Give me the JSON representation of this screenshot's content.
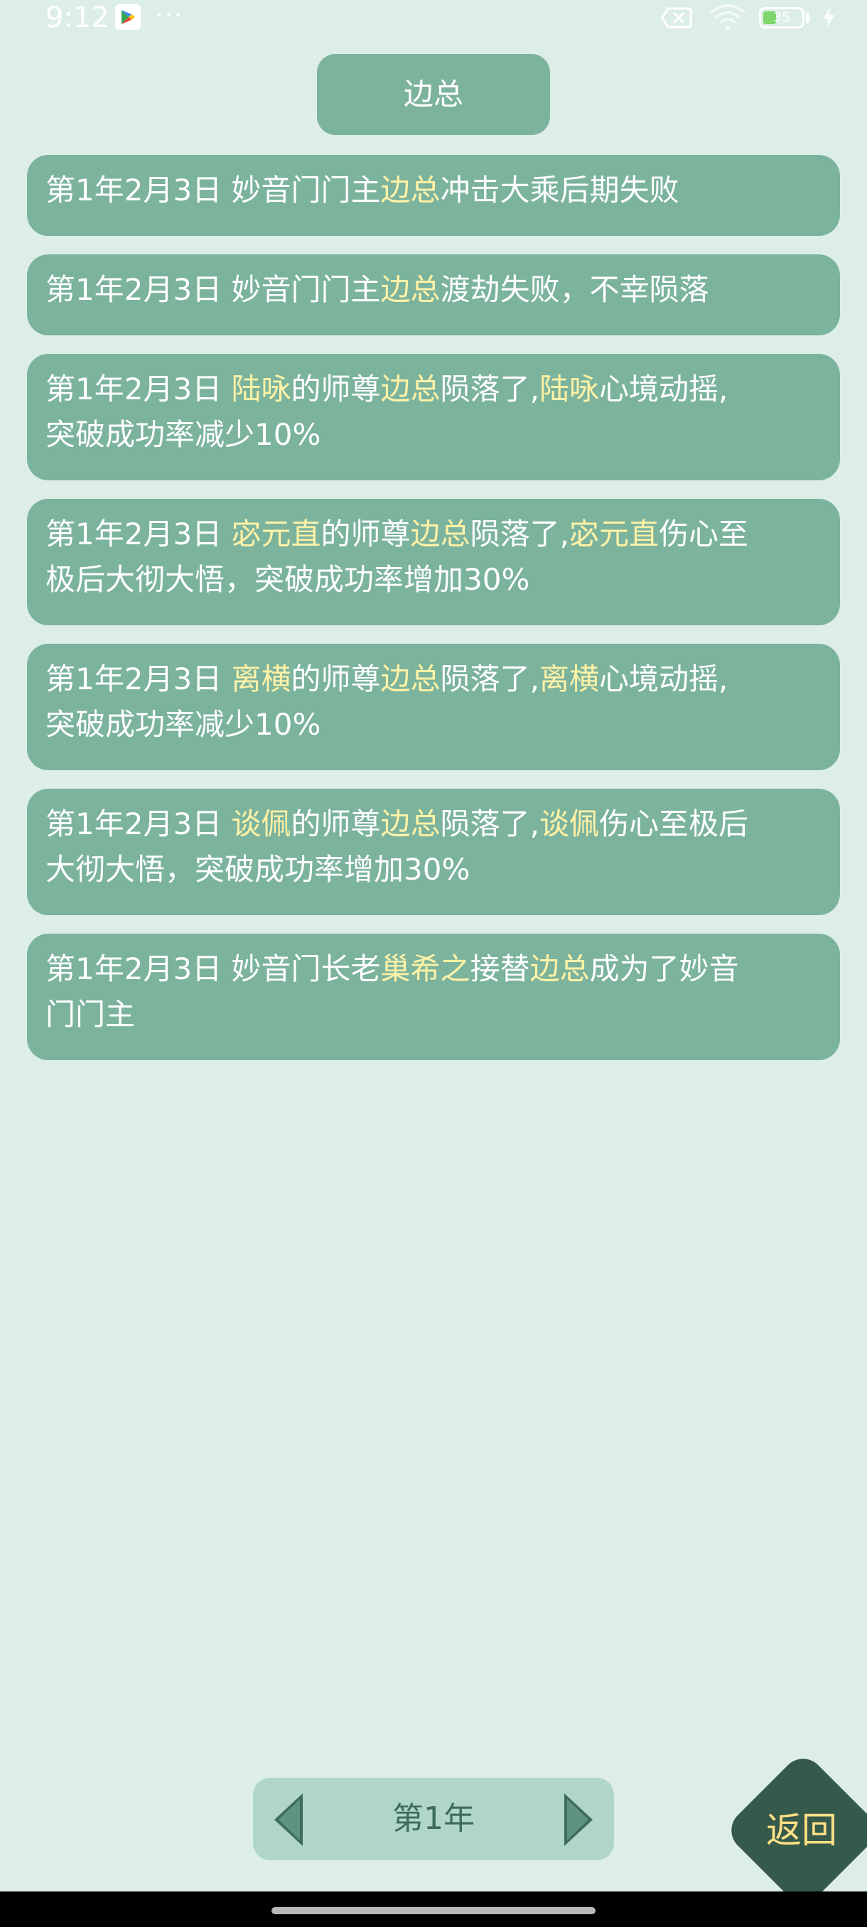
{
  "status_bar": {
    "time": "9:12",
    "dots": "···",
    "battery_level": "35",
    "battery_percent": 35,
    "battery_fill_color": "#7fd66c",
    "icons": [
      "play-store-icon",
      "sim-off-icon",
      "wifi-icon",
      "battery-icon",
      "charging-bolt-icon"
    ]
  },
  "header": {
    "title": "边总"
  },
  "events": [
    {
      "date": "第1年2月3日",
      "parts": [
        {
          "text": "妙音门门主",
          "highlight": false
        },
        {
          "text": "边总",
          "highlight": true
        },
        {
          "text": "冲击大乘后期失败",
          "highlight": false
        }
      ]
    },
    {
      "date": "第1年2月3日",
      "parts": [
        {
          "text": "妙音门门主",
          "highlight": false
        },
        {
          "text": "边总",
          "highlight": true
        },
        {
          "text": "渡劫失败，不幸陨落",
          "highlight": false
        }
      ]
    },
    {
      "date": "第1年2月3日",
      "parts": [
        {
          "text": "陆咏",
          "highlight": true
        },
        {
          "text": "的师尊",
          "highlight": false
        },
        {
          "text": "边总",
          "highlight": true
        },
        {
          "text": "陨落了,",
          "highlight": false
        },
        {
          "text": "陆咏",
          "highlight": true
        },
        {
          "text": "心境动摇,",
          "highlight": false
        },
        {
          "text": "突破成功率减少10%",
          "highlight": false,
          "newline": true
        }
      ]
    },
    {
      "date": "第1年2月3日",
      "parts": [
        {
          "text": "宓元直",
          "highlight": true
        },
        {
          "text": "的师尊",
          "highlight": false
        },
        {
          "text": "边总",
          "highlight": true
        },
        {
          "text": "陨落了,",
          "highlight": false
        },
        {
          "text": "宓元直",
          "highlight": true
        },
        {
          "text": "伤心至",
          "highlight": false
        },
        {
          "text": "极后大彻大悟，突破成功率增加30%",
          "highlight": false,
          "newline": true
        }
      ]
    },
    {
      "date": "第1年2月3日",
      "parts": [
        {
          "text": "离横",
          "highlight": true
        },
        {
          "text": "的师尊",
          "highlight": false
        },
        {
          "text": "边总",
          "highlight": true
        },
        {
          "text": "陨落了,",
          "highlight": false
        },
        {
          "text": "离横",
          "highlight": true
        },
        {
          "text": "心境动摇,",
          "highlight": false
        },
        {
          "text": "突破成功率减少10%",
          "highlight": false,
          "newline": true
        }
      ]
    },
    {
      "date": "第1年2月3日",
      "parts": [
        {
          "text": "谈佩",
          "highlight": true
        },
        {
          "text": "的师尊",
          "highlight": false
        },
        {
          "text": "边总",
          "highlight": true
        },
        {
          "text": "陨落了,",
          "highlight": false
        },
        {
          "text": "谈佩",
          "highlight": true
        },
        {
          "text": "伤心至极后",
          "highlight": false
        },
        {
          "text": "大彻大悟，突破成功率增加30%",
          "highlight": false,
          "newline": true
        }
      ]
    },
    {
      "date": "第1年2月3日",
      "parts": [
        {
          "text": "妙音门长老",
          "highlight": false
        },
        {
          "text": "巢希之",
          "highlight": true
        },
        {
          "text": "接替",
          "highlight": false
        },
        {
          "text": "边总",
          "highlight": true
        },
        {
          "text": "成为了妙音",
          "highlight": false
        },
        {
          "text": "门门主",
          "highlight": false,
          "newline": true
        }
      ]
    }
  ],
  "pager": {
    "label": "第1年",
    "prev_icon": "triangle-left-icon",
    "next_icon": "triangle-right-icon"
  },
  "return_button": {
    "label": "返回"
  },
  "colors": {
    "background": "#ddeee8",
    "card": "#7bb39d",
    "highlight_text": "#fff2a6",
    "pager_bg": "#b0d6c8",
    "pager_text": "#3d6b5c",
    "return_bg": "#35594a",
    "return_text": "#ffdf85"
  }
}
